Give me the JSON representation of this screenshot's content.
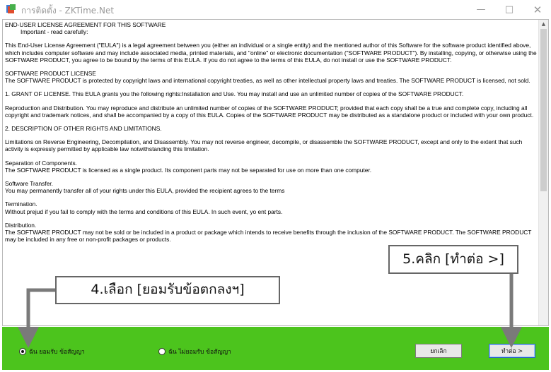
{
  "window": {
    "title": "การติดตั้ง - ZKTime.Net",
    "minimize_glyph": "—",
    "maximize_glyph": "□",
    "close_glyph": "✕"
  },
  "eula": {
    "paragraphs": [
      "END-USER LICENSE AGREEMENT FOR THIS SOFTWARE",
      "This End-User License Agreement (\"EULA\") is a legal agreement between you (either an individual or a single entity) and the mentioned author of this Software for the software product identified above, which includes computer software and may include associated media, printed materials, and \"online\" or electronic documentation (\"SOFTWARE PRODUCT\"). By installing, copying, or otherwise using the SOFTWARE PRODUCT, you agree to be bound by the terms of this EULA. If you do not agree to the terms of this EULA, do not install or use the SOFTWARE PRODUCT.",
      "SOFTWARE PRODUCT LICENSE\nThe SOFTWARE PRODUCT is protected by copyright laws and international copyright treaties, as well as other intellectual property laws and treaties. The SOFTWARE PRODUCT is licensed, not sold.",
      "1. GRANT OF LICENSE. This EULA grants you the following rights:Installation and Use. You may install and use an unlimited number of copies of the SOFTWARE PRODUCT.",
      "Reproduction and Distribution. You may reproduce and distribute an unlimited number of copies of the SOFTWARE PRODUCT; provided that each copy shall be a true and complete copy, including all copyright and trademark notices, and shall be accompanied by a copy of this EULA. Copies of the SOFTWARE PRODUCT may be distributed as a standalone product or included with your own product.",
      "2. DESCRIPTION OF OTHER RIGHTS AND LIMITATIONS.",
      "Limitations on Reverse Engineering, Decompilation, and Disassembly. You may not reverse engineer, decompile, or disassemble the SOFTWARE PRODUCT, except and only to the extent that such activity is expressly permitted by applicable law notwithstanding this limitation.",
      "Separation of Components.\nThe SOFTWARE PRODUCT is licensed as a single product. Its component parts may not be separated for use on more than one computer.",
      "Software Transfer.\nYou may permanently transfer all of your rights under this EULA, provided the recipient agrees to the terms",
      "Termination.\nWithout prejud                                                                                                              if you fail to comply with the terms and conditions of this EULA. In such event, yo                                                                                                          ent parts.",
      "Distribution.\nThe SOFTWARE PRODUCT may not be sold or be included in a product or package which intends to receive benefits through the inclusion of the SOFTWARE PRODUCT. The SOFTWARE PRODUCT may be included in any free or non-profit packages or products."
    ],
    "subtitle": "Important - read carefully:"
  },
  "options": {
    "accept_label": "ฉัน ยอมรับ ข้อสัญญา",
    "decline_label": "ฉัน ไม่ยอมรับ ข้อสัญญา",
    "selected": "accept"
  },
  "buttons": {
    "cancel_label": "ยกเลิก",
    "next_label": "ทำต่อ >"
  },
  "annotations": {
    "step4": "4.เลือก [ยอมรับข้อตกลงฯ]",
    "step5": "5.คลิก [ทำต่อ >]"
  },
  "colors": {
    "bottom_bar": "#4cc41d",
    "callout_arrow": "#7a7a7a"
  }
}
